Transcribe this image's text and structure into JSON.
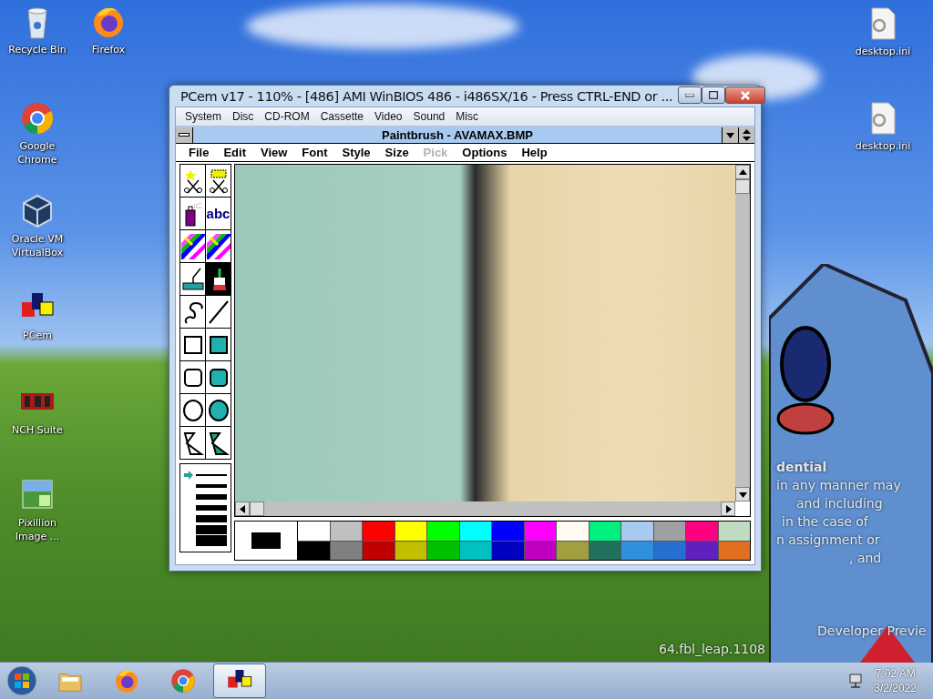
{
  "desktop_icons": [
    {
      "kind": "recycle",
      "label": "Recycle Bin"
    },
    {
      "kind": "firefox",
      "label": "Firefox"
    },
    {
      "kind": "chrome",
      "label": "Google Chrome"
    },
    {
      "kind": "virtualbox",
      "label": "Oracle VM VirtualBox"
    },
    {
      "kind": "pcem",
      "label": "PCem"
    },
    {
      "kind": "nch",
      "label": "NCH Suite"
    },
    {
      "kind": "pixillion",
      "label": "Pixillion Image ..."
    },
    {
      "kind": "ini",
      "label": "desktop.ini"
    },
    {
      "kind": "ini",
      "label": "desktop.ini"
    }
  ],
  "watermark_fragments": [
    {
      "text": "dential",
      "bold": true
    },
    {
      "text": "in any manner may",
      "bold": false
    },
    {
      "text": "and including",
      "bold": false
    },
    {
      "text": "in the case of",
      "bold": false
    },
    {
      "text": "n assignment or",
      "bold": false
    },
    {
      "text": ", and",
      "bold": false
    },
    {
      "text": "Developer Previe",
      "bold": false
    },
    {
      "text": "64.fbl_leap.1108",
      "bold": false
    }
  ],
  "window": {
    "title": "PCem v17 - 110% - [486] AMI WinBIOS 486 - i486SX/16 - Press CTRL-END or ...",
    "menu": [
      "System",
      "Disc",
      "CD-ROM",
      "Cassette",
      "Video",
      "Sound",
      "Misc"
    ],
    "paintbrush": {
      "title": "Paintbrush - AVAMAX.BMP",
      "menu": [
        {
          "label": "File",
          "disabled": false
        },
        {
          "label": "Edit",
          "disabled": false
        },
        {
          "label": "View",
          "disabled": false
        },
        {
          "label": "Font",
          "disabled": false
        },
        {
          "label": "Style",
          "disabled": false
        },
        {
          "label": "Size",
          "disabled": false
        },
        {
          "label": "Pick",
          "disabled": true
        },
        {
          "label": "Options",
          "disabled": false
        },
        {
          "label": "Help",
          "disabled": false
        }
      ],
      "tools": [
        {
          "kind": "scissors-star",
          "selected": false
        },
        {
          "kind": "scissors-rect",
          "selected": false
        },
        {
          "kind": "spraycan",
          "selected": false
        },
        {
          "kind": "text",
          "label": "abc",
          "selected": false
        },
        {
          "kind": "color-eraser",
          "selected": false
        },
        {
          "kind": "eraser",
          "selected": false
        },
        {
          "kind": "roller",
          "selected": false
        },
        {
          "kind": "brush",
          "selected": true
        },
        {
          "kind": "curve",
          "selected": false
        },
        {
          "kind": "line",
          "selected": false
        },
        {
          "kind": "box",
          "selected": false
        },
        {
          "kind": "filled-box",
          "selected": false
        },
        {
          "kind": "rounded-box",
          "selected": false
        },
        {
          "kind": "filled-rounded-box",
          "selected": false
        },
        {
          "kind": "circle",
          "selected": false
        },
        {
          "kind": "filled-circle",
          "selected": false
        },
        {
          "kind": "polygon",
          "selected": false
        },
        {
          "kind": "filled-polygon",
          "selected": false
        }
      ],
      "line_widths": [
        {
          "selected": true
        },
        {
          "selected": false
        },
        {
          "selected": false
        },
        {
          "selected": false
        },
        {
          "selected": false
        },
        {
          "selected": false
        },
        {
          "selected": false
        }
      ],
      "current_colors": [
        {
          "color": "#000000"
        },
        {
          "color": "#ffffff"
        }
      ],
      "palette": [
        {
          "color": "#ffffff"
        },
        {
          "color": "#c0c0c0"
        },
        {
          "color": "#ff0000"
        },
        {
          "color": "#ffff00"
        },
        {
          "color": "#00ff00"
        },
        {
          "color": "#00ffff"
        },
        {
          "color": "#0000ff"
        },
        {
          "color": "#ff00ff"
        },
        {
          "color": "#fffbf0"
        },
        {
          "color": "#00f080"
        },
        {
          "color": "#a6caf0"
        },
        {
          "color": "#a0a0a4"
        },
        {
          "color": "#ff0080"
        },
        {
          "color": "#c0dcc0"
        },
        {
          "color": "#000000"
        },
        {
          "color": "#808080"
        },
        {
          "color": "#c00000"
        },
        {
          "color": "#c0c000"
        },
        {
          "color": "#00c000"
        },
        {
          "color": "#00c0c0"
        },
        {
          "color": "#0000c0"
        },
        {
          "color": "#c000c0"
        },
        {
          "color": "#a0a040"
        },
        {
          "color": "#207060"
        },
        {
          "color": "#3090e0"
        },
        {
          "color": "#2870d0"
        },
        {
          "color": "#6020c0"
        },
        {
          "color": "#e07020"
        }
      ]
    }
  },
  "taskbar": {
    "items": [
      {
        "kind": "folder",
        "active": false
      },
      {
        "kind": "firefox",
        "active": false
      },
      {
        "kind": "chrome",
        "active": false
      },
      {
        "kind": "pcem",
        "active": true
      }
    ],
    "time": "7:02 AM",
    "date": "3/2/2022"
  }
}
